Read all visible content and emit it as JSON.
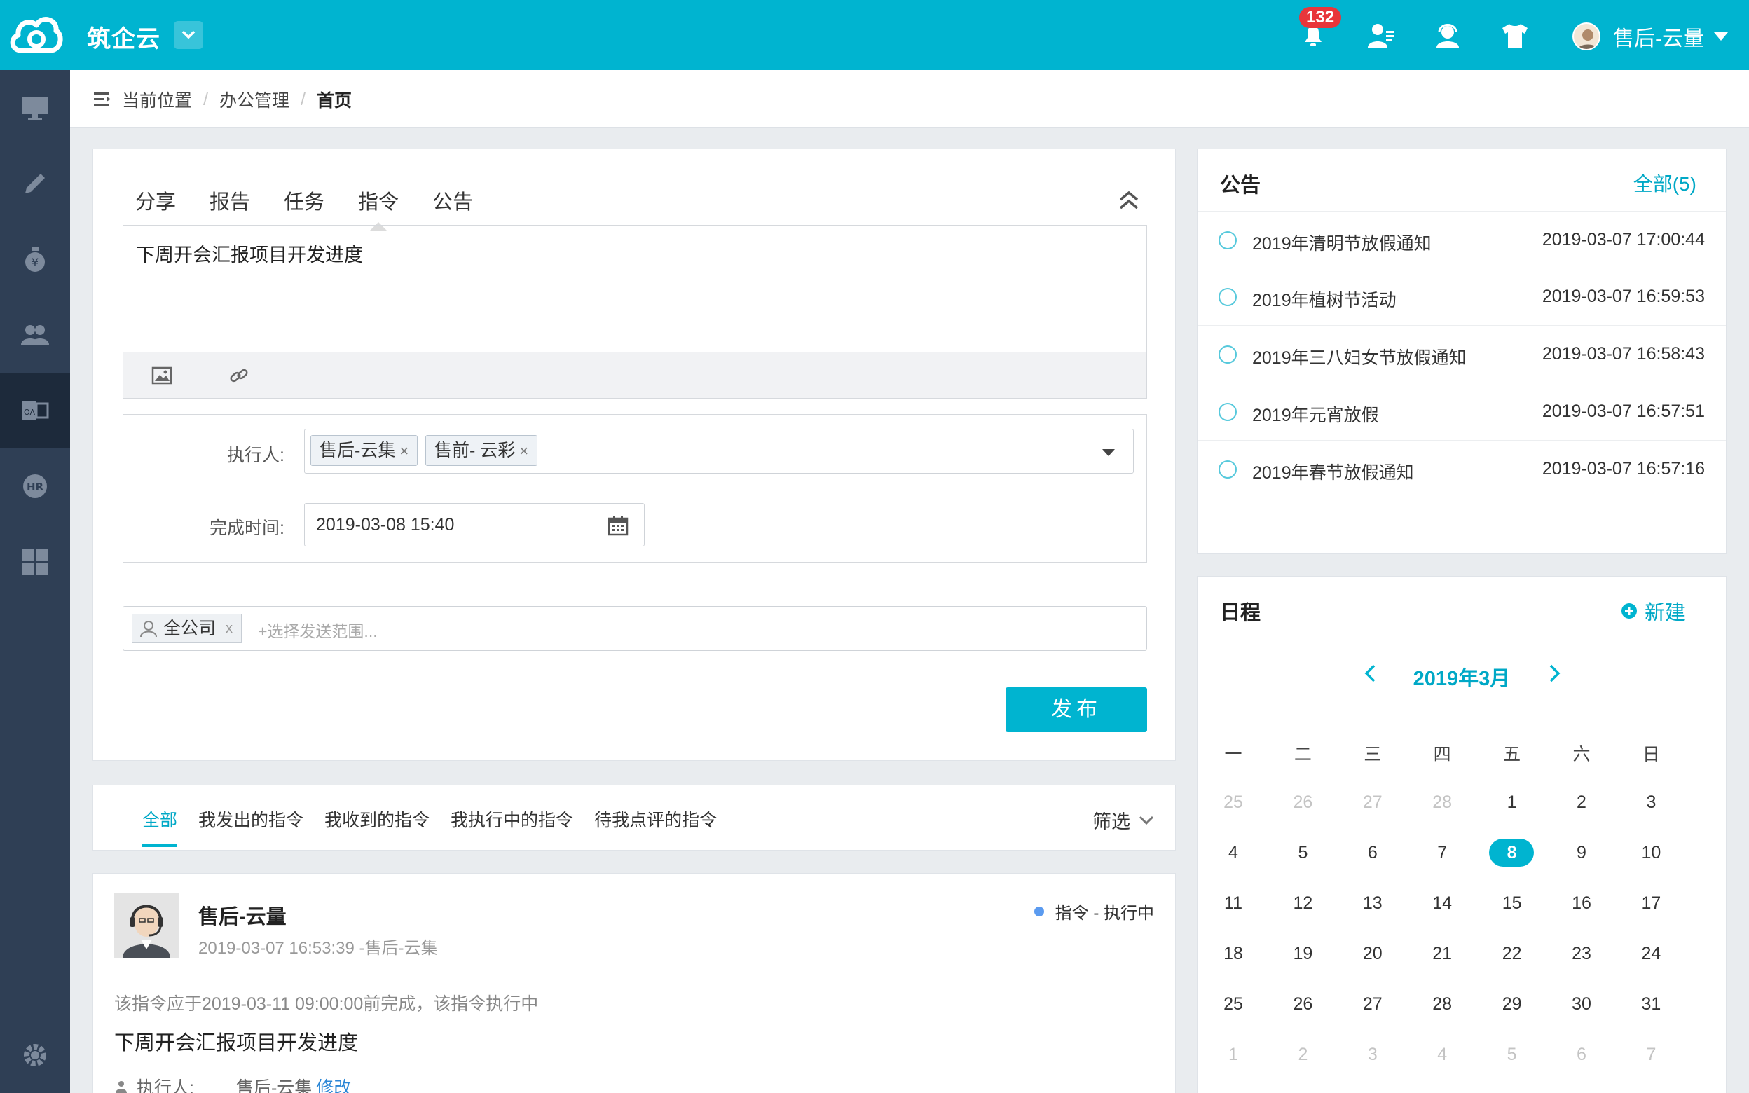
{
  "topbar": {
    "brand": "筑企云",
    "notification_count": "132",
    "user_name": "售后-云量"
  },
  "breadcrumb": {
    "label": "当前位置",
    "level1": "办公管理",
    "current": "首页"
  },
  "composer": {
    "tabs": [
      "分享",
      "报告",
      "任务",
      "指令",
      "公告"
    ],
    "active_tab": "指令",
    "content": "下周开会汇报项目开发进度",
    "executor_label": "执行人:",
    "executors": [
      "售后-云集",
      "售前- 云彩"
    ],
    "deadline_label": "完成时间:",
    "deadline_value": "2019-03-08 15:40",
    "scope_tag": "全公司",
    "scope_remove": "x",
    "scope_placeholder": "+选择发送范围...",
    "publish_label": "发布"
  },
  "filter_tabs": {
    "items": [
      "全部",
      "我发出的指令",
      "我收到的指令",
      "我执行中的指令",
      "待我点评的指令"
    ],
    "active": "全部",
    "filter_label": "筛选"
  },
  "post": {
    "author": "售后-云量",
    "time_line": "2019-03-07 16:53:39 -售后-云集",
    "status": "指令 - 执行中",
    "note": "该指令应于2019-03-11 09:00:00前完成，该指令执行中",
    "content": "下周开会汇报项目开发进度",
    "executor_label": "执行人:",
    "executor_name": "售后-云集",
    "edit_link": "修改"
  },
  "announcements": {
    "title": "公告",
    "all_link": "全部(5)",
    "items": [
      {
        "title": "2019年清明节放假通知",
        "date": "2019-03-07 17:00:44"
      },
      {
        "title": "2019年植树节活动",
        "date": "2019-03-07 16:59:53"
      },
      {
        "title": "2019年三八妇女节放假通知",
        "date": "2019-03-07 16:58:43"
      },
      {
        "title": "2019年元宵放假",
        "date": "2019-03-07 16:57:51"
      },
      {
        "title": "2019年春节放假通知",
        "date": "2019-03-07 16:57:16"
      }
    ]
  },
  "schedule": {
    "title": "日程",
    "new_label": "新建",
    "month_label": "2019年3月",
    "weekdays": [
      "一",
      "二",
      "三",
      "四",
      "五",
      "六",
      "日"
    ],
    "today": 8,
    "weeks": [
      [
        "25",
        "26",
        "27",
        "28",
        "1",
        "2",
        "3"
      ],
      [
        "4",
        "5",
        "6",
        "7",
        "8",
        "9",
        "10"
      ],
      [
        "11",
        "12",
        "13",
        "14",
        "15",
        "16",
        "17"
      ],
      [
        "18",
        "19",
        "20",
        "21",
        "22",
        "23",
        "24"
      ],
      [
        "25",
        "26",
        "27",
        "28",
        "29",
        "30",
        "31"
      ],
      [
        "1",
        "2",
        "3",
        "4",
        "5",
        "6",
        "7"
      ]
    ],
    "muted_first_row": 4,
    "muted_last_row": 7
  },
  "colors": {
    "accent": "#00b4d0",
    "sidebar": "#2f3f55",
    "badge": "#e8363b",
    "status_dot": "#5b9bf0"
  },
  "sidebar_icons": [
    "desktop-icon",
    "pencil-icon",
    "money-bag-icon",
    "users-icon",
    "office-icon",
    "hr-icon",
    "grid-icon",
    "settings-icon"
  ]
}
